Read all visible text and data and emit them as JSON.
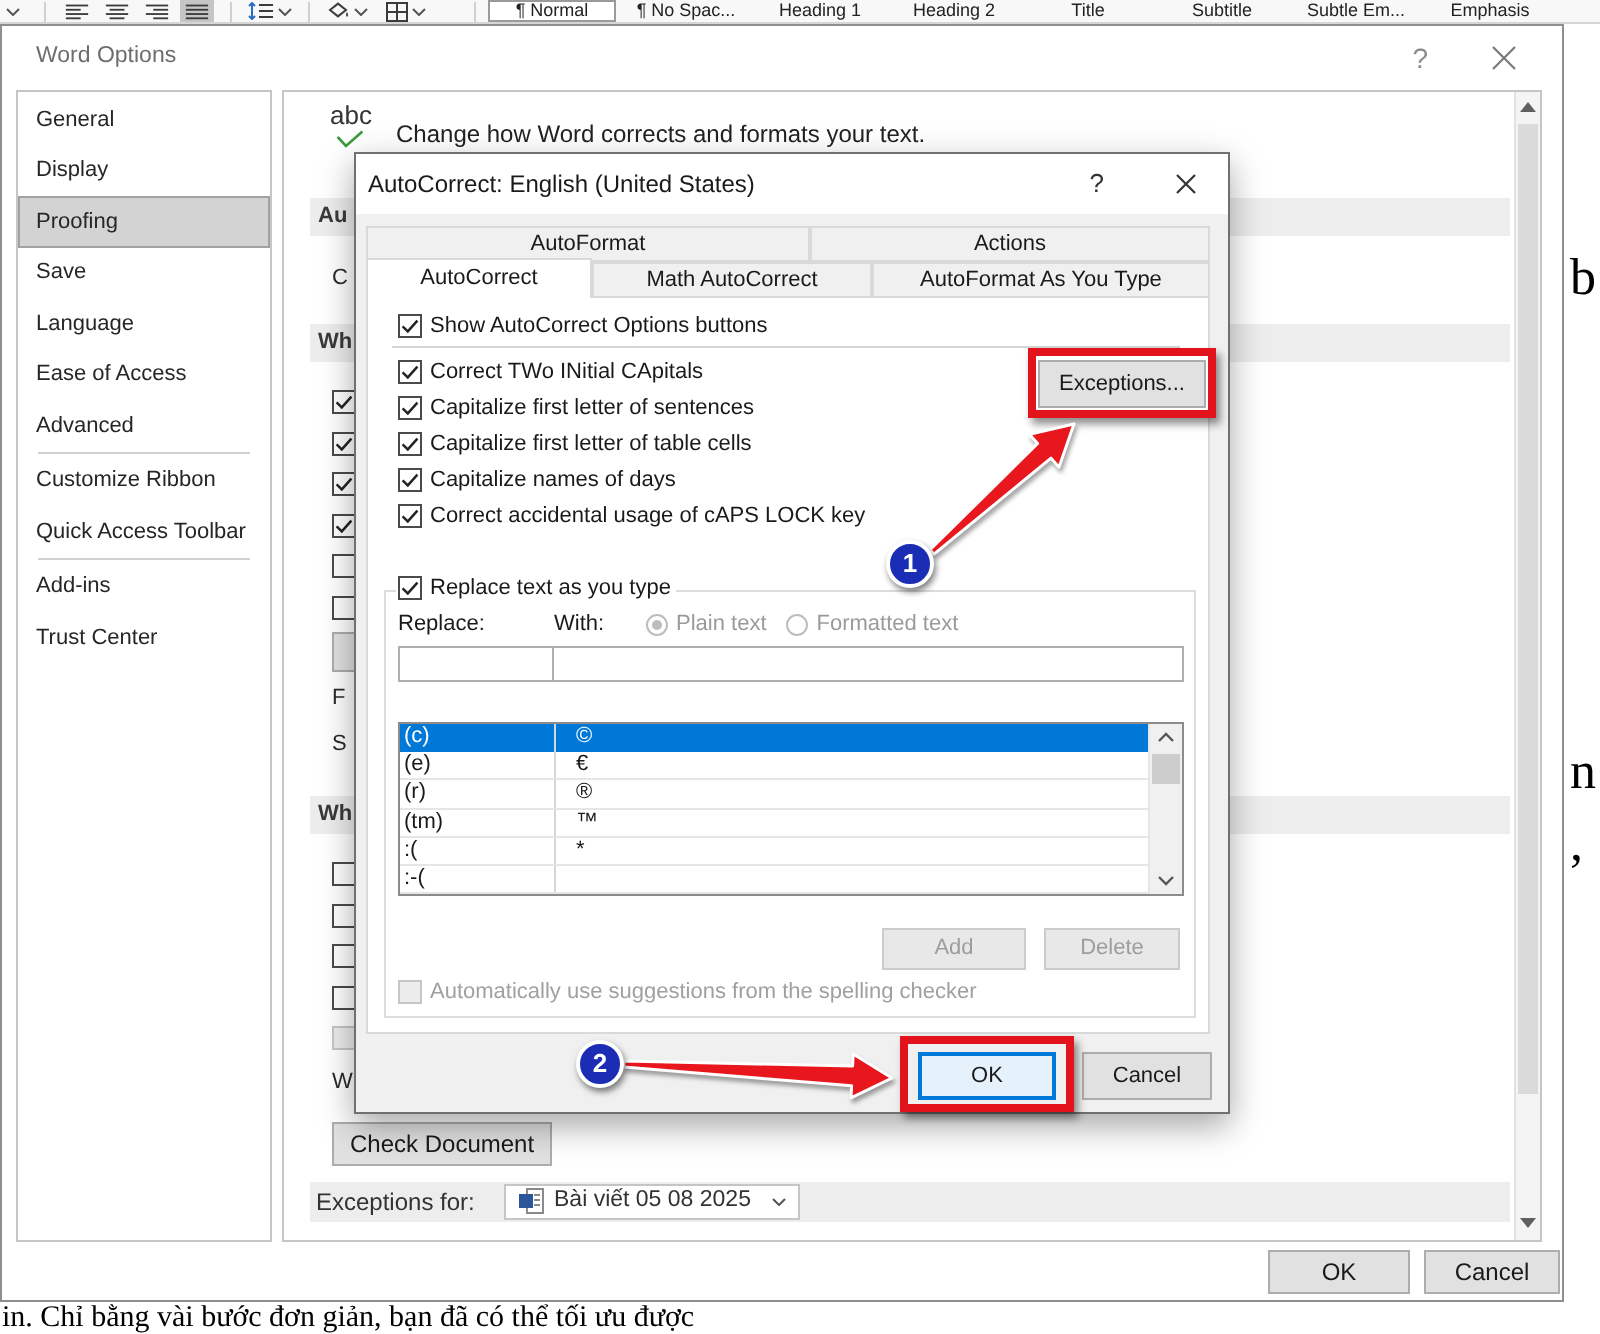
{
  "ribbon": {
    "alignment_buttons": [
      {
        "kind": "left",
        "selected": false
      },
      {
        "kind": "center",
        "selected": false
      },
      {
        "kind": "right",
        "selected": false
      },
      {
        "kind": "justify",
        "selected": true
      }
    ],
    "styles": [
      {
        "label": "¶ Normal",
        "selected": true
      },
      {
        "label": "¶ No Spac...",
        "selected": false
      },
      {
        "label": "Heading 1",
        "selected": false
      },
      {
        "label": "Heading 2",
        "selected": false
      },
      {
        "label": "Title",
        "selected": false
      },
      {
        "label": "Subtitle",
        "selected": false
      },
      {
        "label": "Subtle Em...",
        "selected": false
      },
      {
        "label": "Emphasis",
        "selected": false
      }
    ]
  },
  "options_window": {
    "title": "Word Options",
    "help": "?",
    "sidebar": {
      "groups": [
        {
          "items": [
            {
              "label": "General",
              "selected": false
            },
            {
              "label": "Display",
              "selected": false
            },
            {
              "label": "Proofing",
              "selected": true
            },
            {
              "label": "Save",
              "selected": false
            },
            {
              "label": "Language",
              "selected": false
            },
            {
              "label": "Ease of Access",
              "selected": false
            },
            {
              "label": "Advanced",
              "selected": false
            }
          ]
        },
        {
          "items": [
            {
              "label": "Customize Ribbon",
              "selected": false
            },
            {
              "label": "Quick Access Toolbar",
              "selected": false
            }
          ]
        },
        {
          "items": [
            {
              "label": "Add-ins",
              "selected": false
            },
            {
              "label": "Trust Center",
              "selected": false
            }
          ]
        }
      ]
    },
    "header": {
      "icon_text": "abc",
      "text": "Change how Word corrects and formats your text."
    },
    "sections": [
      {
        "heading": "Au",
        "rows": [
          {
            "kind": "text",
            "text": "C"
          }
        ]
      },
      {
        "heading": "Wh",
        "rows": [
          {
            "kind": "checkbox",
            "checked": true,
            "disabled": false
          },
          {
            "kind": "checkbox",
            "checked": true,
            "disabled": false
          },
          {
            "kind": "checkbox",
            "checked": true,
            "disabled": false
          },
          {
            "kind": "checkbox",
            "checked": true,
            "disabled": false
          },
          {
            "kind": "checkbox",
            "checked": false,
            "disabled": false
          },
          {
            "kind": "checkbox",
            "checked": false,
            "disabled": false
          },
          {
            "kind": "button"
          },
          {
            "kind": "text",
            "text": "F"
          },
          {
            "kind": "text",
            "text": "S"
          }
        ]
      },
      {
        "heading": "Wh",
        "rows": [
          {
            "kind": "checkbox",
            "checked": false,
            "disabled": false
          },
          {
            "kind": "checkbox",
            "checked": false,
            "disabled": false
          },
          {
            "kind": "checkbox",
            "checked": false,
            "disabled": false
          },
          {
            "kind": "checkbox",
            "checked": false,
            "disabled": false
          },
          {
            "kind": "checkbox",
            "checked": false,
            "disabled": true
          },
          {
            "kind": "text",
            "text": "W"
          },
          {
            "kind": "button",
            "label": "Check Document"
          }
        ]
      }
    ],
    "exceptions": {
      "label": "Exceptions for:",
      "document": "Bài viết 05 08 2025"
    },
    "buttons": [
      {
        "label": "OK"
      },
      {
        "label": "Cancel"
      }
    ]
  },
  "autocorrect_dialog": {
    "title": "AutoCorrect: English (United States)",
    "help": "?",
    "tab_rows": [
      [
        {
          "label": "AutoFormat",
          "selected": false
        },
        {
          "label": "Actions",
          "selected": false
        }
      ],
      [
        {
          "label": "AutoCorrect",
          "selected": true
        },
        {
          "label": "Math AutoCorrect",
          "selected": false
        },
        {
          "label": "AutoFormat As You Type",
          "selected": false
        }
      ]
    ],
    "show_options_buttons": {
      "label": "Show AutoCorrect Options buttons",
      "checked": true
    },
    "options": [
      {
        "label": "Correct TWo INitial CApitals",
        "checked": true
      },
      {
        "label": "Capitalize first letter of sentences",
        "checked": true
      },
      {
        "label": "Capitalize first letter of table cells",
        "checked": true
      },
      {
        "label": "Capitalize names of days",
        "checked": true
      },
      {
        "label": "Correct accidental usage of cAPS LOCK key",
        "checked": true
      }
    ],
    "exceptions_button": "Exceptions...",
    "replace": {
      "label": "Replace text as you type",
      "checked": true,
      "replace_label": "Replace:",
      "with_label": "With:",
      "formats": [
        {
          "label": "Plain text",
          "selected": true,
          "disabled": true
        },
        {
          "label": "Formatted text",
          "selected": false,
          "disabled": true
        }
      ],
      "entries": [
        {
          "replace": "(c)",
          "with": "©",
          "selected": true
        },
        {
          "replace": "(e)",
          "with": "€",
          "selected": false
        },
        {
          "replace": "(r)",
          "with": "®",
          "selected": false
        },
        {
          "replace": "(tm)",
          "with": "™",
          "selected": false
        },
        {
          "replace": ":(",
          "with": "*",
          "selected": false
        },
        {
          "replace": ":-(",
          "selected": false
        }
      ],
      "add_button": {
        "label": "Add",
        "disabled": true
      },
      "delete_button": {
        "label": "Delete",
        "disabled": true
      },
      "suggestions": {
        "label": "Automatically use suggestions from the spelling checker",
        "checked": false,
        "disabled": true
      }
    },
    "buttons": [
      {
        "label": "OK",
        "default": true
      },
      {
        "label": "Cancel",
        "default": false
      }
    ]
  },
  "annotations": {
    "badges": [
      {
        "label": "1"
      },
      {
        "label": "2"
      }
    ]
  },
  "document": {
    "edge_letters": [
      "b",
      "n",
      ","
    ],
    "bottom_line": "in. Chỉ bằng vài bước đơn giản, bạn đã có thể tối ưu được"
  }
}
